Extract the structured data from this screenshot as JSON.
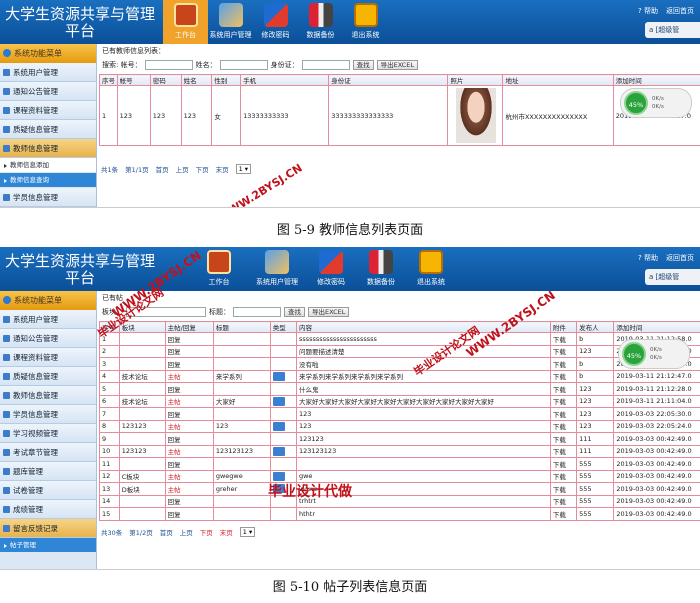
{
  "screen1": {
    "app_title": "大学生资源共享与管理平台",
    "nav": [
      "工作台",
      "系统用户管理",
      "修改密码",
      "数据备份",
      "退出系统"
    ],
    "top_links": [
      "帮助",
      "返回首页"
    ],
    "user_label": "a [超级管",
    "sidebar_header": "系统功能菜单",
    "sidebar_items": [
      "系统用户管理",
      "通知公告管理",
      "课程资料管理",
      "质疑信息管理",
      "教师信息管理"
    ],
    "sidebar_sub": [
      "教师信息添加",
      "教师信息查询"
    ],
    "sidebar_more": "学员信息管理",
    "main_title": "已有教师信息列表：",
    "search": {
      "account": "搜索: 帐号：",
      "name": "姓名：",
      "idcard": "身份证：",
      "query": "查找",
      "export": "导出EXCEL"
    },
    "columns": [
      "序号",
      "帐号",
      "密码",
      "姓名",
      "性别",
      "手机",
      "身份证",
      "照片",
      "地址",
      "添加时间"
    ],
    "row": [
      "1",
      "123",
      "123",
      "123",
      "女",
      "13333333333",
      "333333333333333",
      "",
      "杭州市XXXXXXXXXXXXXX",
      "2019-03-04 15:32:17.0"
    ],
    "pager": [
      "共1条",
      "第1/1页",
      "首页",
      "上页",
      "下页",
      "末页",
      "1 ▾"
    ],
    "widget": {
      "pct": "45%",
      "up": "0K/s",
      "down": "0K/s"
    },
    "watermark": "WWW.2BYSJ.CN",
    "caption": "图 5-9 教师信息列表页面"
  },
  "screen2": {
    "app_title": "大学生资源共享与管理平台",
    "nav": [
      "工作台",
      "系统用户管理",
      "修改密码",
      "数据备份",
      "退出系统"
    ],
    "top_links": [
      "帮助",
      "返回首页"
    ],
    "user_label": "a [超级管",
    "sidebar_header": "系统功能菜单",
    "sidebar_items": [
      "系统用户管理",
      "通知公告管理",
      "课程资料管理",
      "质疑信息管理",
      "教师信息管理",
      "学员信息管理",
      "学习视频管理",
      "考试章节管理",
      "题库管理",
      "试卷管理",
      "成绩管理",
      "留言反馈记录"
    ],
    "sidebar_sub": [
      "帖子管理"
    ],
    "main_title": "已有帖",
    "search": {
      "block": "板块：",
      "title": "标题：",
      "query": "查找",
      "export": "导出EXCEL"
    },
    "columns": [
      "序号",
      "板块",
      "主帖/回复",
      "标题",
      "类型",
      "内容",
      "附件",
      "发布人",
      "添加时间"
    ],
    "rows": [
      [
        "1",
        "",
        "回复",
        "",
        "",
        "sssssssssssssssssssssss",
        "下载",
        "b",
        "2019-03-11 21:12:58.0"
      ],
      [
        "2",
        "",
        "回复",
        "",
        "",
        "问题要描述清楚",
        "下载",
        "123",
        "2019-03-11 21:12:58.0"
      ],
      [
        "3",
        "",
        "回复",
        "",
        "",
        "没有啦",
        "下载",
        "b",
        "2019-03-11 21:12:58.0"
      ],
      [
        "4",
        "技术论坛",
        "主帖",
        "来学系列",
        "",
        "来学系列来学系列来学系列来学系列",
        "下载",
        "b",
        "2019-03-11 21:12:47.0"
      ],
      [
        "5",
        "",
        "回复",
        "",
        "",
        "什么鬼",
        "下载",
        "123",
        "2019-03-11 21:12:28.0"
      ],
      [
        "6",
        "技术论坛",
        "主帖",
        "大家好",
        "",
        "大家好大家好大家好大家好大家好大家好大家好大家好大家好大家好",
        "下载",
        "123",
        "2019-03-11 21:11:04.0"
      ],
      [
        "7",
        "",
        "回复",
        "",
        "",
        "123",
        "下载",
        "123",
        "2019-03-03 22:05:30.0"
      ],
      [
        "8",
        "123123",
        "主帖",
        "123",
        "",
        "123",
        "下载",
        "123",
        "2019-03-03 22:05:24.0"
      ],
      [
        "9",
        "",
        "回复",
        "",
        "",
        "123123",
        "下载",
        "111",
        "2019-03-03 00:42:49.0"
      ],
      [
        "10",
        "123123",
        "主帖",
        "123123123",
        "",
        "123123123",
        "下载",
        "111",
        "2019-03-03 00:42:49.0"
      ],
      [
        "11",
        "",
        "回复",
        "",
        "",
        "",
        "下载",
        "555",
        "2019-03-03 00:42:49.0"
      ],
      [
        "12",
        "C板块",
        "主帖",
        "gwegwe",
        "",
        "gwe",
        "下载",
        "555",
        "2019-03-03 00:42:49.0"
      ],
      [
        "13",
        "D板块",
        "主帖",
        "greher",
        "",
        "wgwe",
        "下载",
        "555",
        "2019-03-03 00:42:49.0"
      ],
      [
        "14",
        "",
        "回复",
        "",
        "",
        "trhtrt",
        "下载",
        "555",
        "2019-03-03 00:42:49.0"
      ],
      [
        "15",
        "",
        "回复",
        "",
        "",
        "hthtr",
        "下载",
        "555",
        "2019-03-03 00:42:49.0"
      ]
    ],
    "pager": [
      "共30条",
      "第1/2页",
      "首页",
      "上页",
      "下页",
      "末页",
      "1 ▾"
    ],
    "widget": {
      "pct": "45%",
      "up": "0K/s",
      "down": "0K/s"
    },
    "watermark1": "WWW.2BYSJ.CN",
    "watermark2": "毕业设计论文网",
    "watermark3": "毕业设计代做",
    "caption": "图 5-10 帖子列表信息页面"
  }
}
